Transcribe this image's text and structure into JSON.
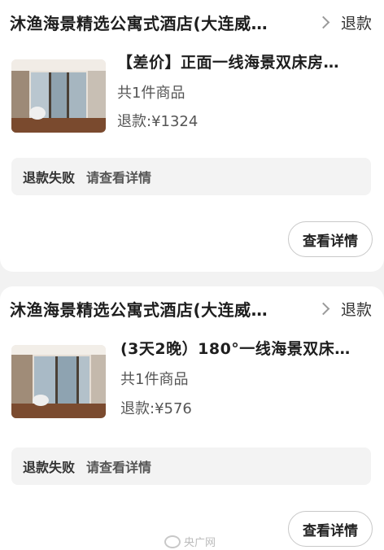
{
  "orders": [
    {
      "shop_name": "沐渔海景精选公寓式酒店(大连威…",
      "header_status": "退款",
      "product_title": "【差价】正面一线海景双床房…",
      "product_count": "共1件商品",
      "refund_text": "退款:¥1324",
      "status_label": "退款失败",
      "status_hint": "请查看详情",
      "detail_button": "查看详情"
    },
    {
      "shop_name": "沐渔海景精选公寓式酒店(大连威…",
      "header_status": "退款",
      "product_title": "(3天2晚）180°一线海景双床…",
      "product_count": "共1件商品",
      "refund_text": "退款:¥576",
      "status_label": "退款失败",
      "status_hint": "请查看详情",
      "detail_button": "查看详情"
    }
  ],
  "watermark": "央广网"
}
